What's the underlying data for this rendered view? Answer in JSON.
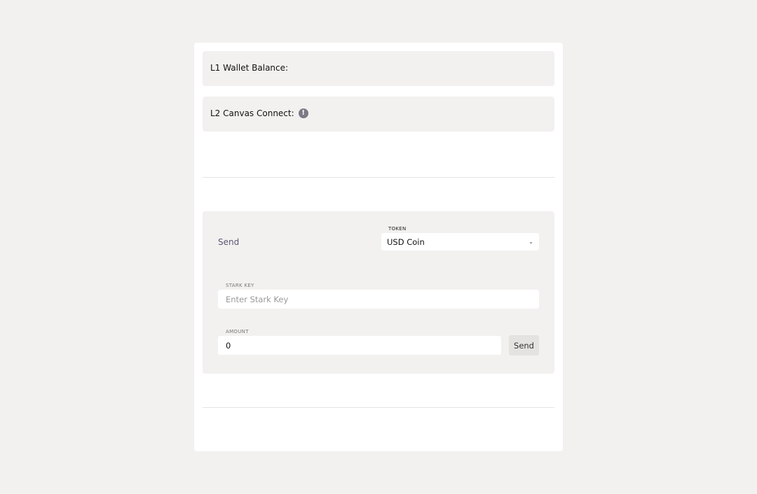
{
  "balance": {
    "label": "L1 Wallet Balance:"
  },
  "connect": {
    "label": "L2 Canvas Connect:",
    "info_icon": "!"
  },
  "send_form": {
    "title": "Send",
    "token": {
      "label": "TOKEN",
      "selected": "USD Coin",
      "chevron": "⌄"
    },
    "stark_key": {
      "label": "STARK KEY",
      "placeholder": "Enter Stark Key",
      "value": ""
    },
    "amount": {
      "label": "AMOUNT",
      "value": "0"
    },
    "send_button_label": "Send"
  },
  "colors": {
    "background": "#f2f1ef",
    "card": "#ffffff",
    "panel": "#f2f1ef",
    "accent_text": "#5c5775",
    "info_icon": "#7d7a87"
  }
}
